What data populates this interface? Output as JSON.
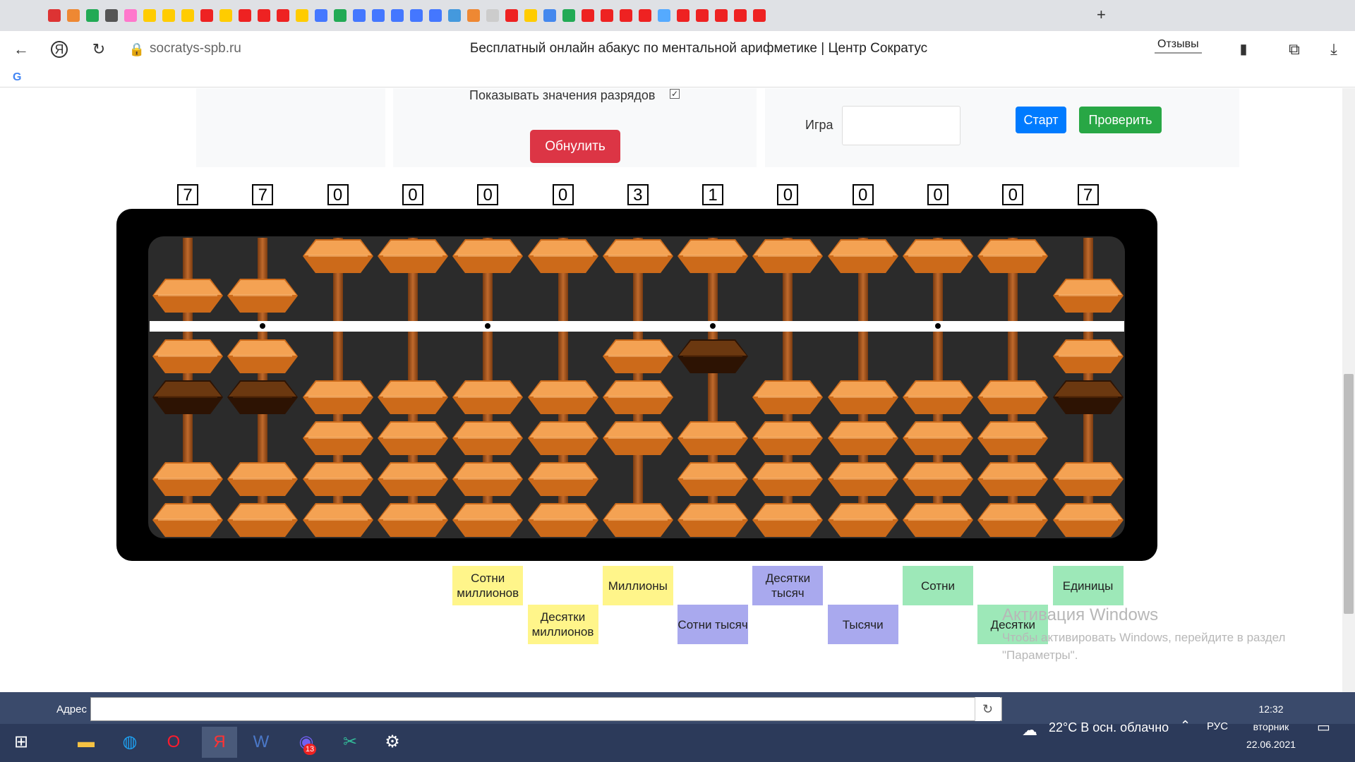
{
  "browser": {
    "url": "socratys-spb.ru",
    "title": "Бесплатный онлайн абакус по ментальной арифметике | Центр Сократус",
    "reviews_label": "Отзывы"
  },
  "controls": {
    "show_values_label": "Показывать значения разрядов",
    "show_values_checked": "✓",
    "reset_label": "Обнулить",
    "game_label": "Игра",
    "game_value": "",
    "start_label": "Старт",
    "check_label": "Проверить"
  },
  "abacus": {
    "digits": [
      "7",
      "7",
      "0",
      "0",
      "0",
      "0",
      "3",
      "1",
      "0",
      "0",
      "0",
      "0",
      "7"
    ],
    "place_labels": [
      {
        "text": "Сотни миллионов",
        "color": "#fff58a"
      },
      {
        "text": "Десятки миллионов",
        "color": "#fff58a"
      },
      {
        "text": "Миллионы",
        "color": "#fff58a"
      },
      {
        "text": "Сотни тысяч",
        "color": "#a9a9ee"
      },
      {
        "text": "Десятки тысяч",
        "color": "#a9a9ee"
      },
      {
        "text": "Тысячи",
        "color": "#a9a9ee"
      },
      {
        "text": "Сотни",
        "color": "#9de8b8"
      },
      {
        "text": "Десятки",
        "color": "#9de8b8"
      },
      {
        "text": "Единицы",
        "color": "#9de8b8"
      }
    ]
  },
  "windows": {
    "watermark_title": "Активация Windows",
    "watermark_text": "Чтобы активировать Windows, перейдите в раздел \"Параметры\".",
    "address_label": "Адрес",
    "address_value": "",
    "weather": "22°C  В осн. облачно",
    "lang": "РУС",
    "time": "12:32",
    "day": "вторник",
    "date": "22.06.2021",
    "badge_count": "13"
  },
  "colors": {
    "bead": "#e98a35",
    "bead_active": "#4a2306",
    "reset": "#dc3545",
    "start": "#007bff",
    "check": "#28a745"
  }
}
